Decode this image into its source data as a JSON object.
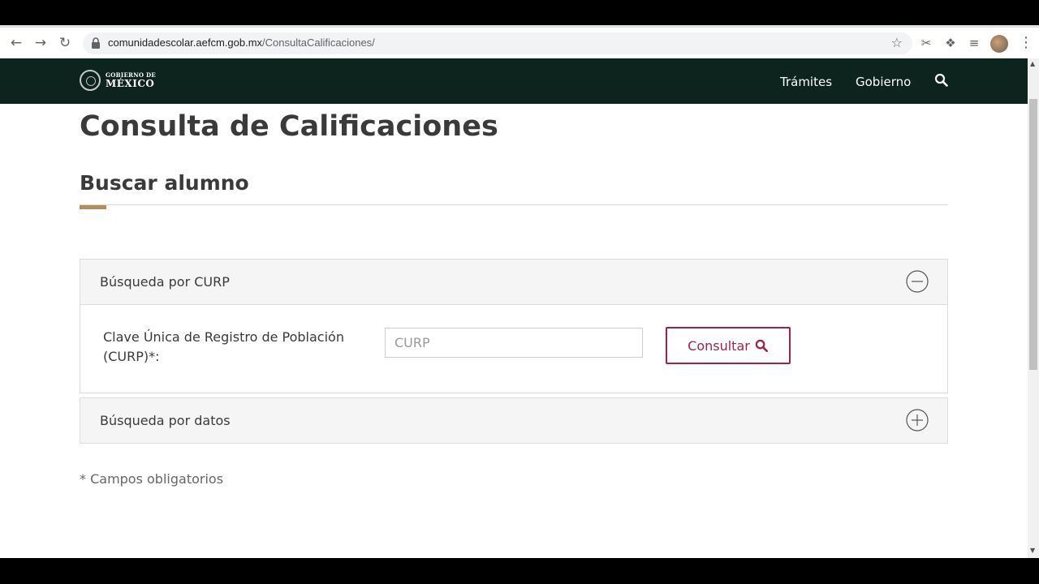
{
  "browser": {
    "url_domain": "comunidadescolar.aefcm.gob.mx",
    "url_path": "/ConsultaCalificaciones/"
  },
  "header": {
    "logo_line1": "GOBIERNO DE",
    "logo_line2": "MÉXICO",
    "nav": [
      "Trámites",
      "Gobierno"
    ],
    "bg_color": "#0c231e"
  },
  "main": {
    "title": "Consulta de Calificaciones",
    "section_title": "Buscar alumno",
    "accent_color": "#b38e5d"
  },
  "panels": {
    "curp": {
      "title": "Búsqueda por CURP",
      "expanded": true,
      "field_label": "Clave Única de Registro de Población (CURP)*:",
      "input_value": "",
      "input_placeholder": "CURP",
      "button_label": "Consultar",
      "button_color": "#9d2449"
    },
    "datos": {
      "title": "Búsqueda por datos",
      "expanded": false
    }
  },
  "footer_note": "* Campos obligatorios"
}
